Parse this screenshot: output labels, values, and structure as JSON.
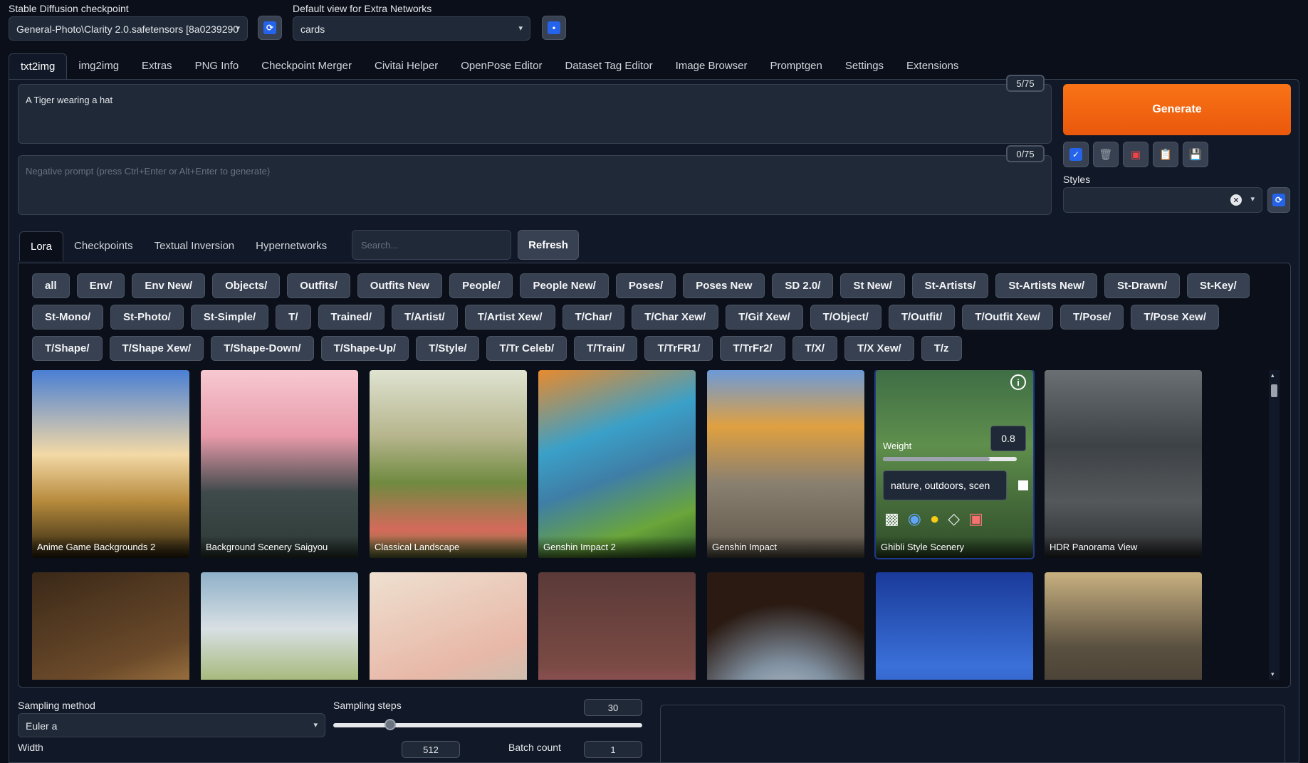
{
  "top": {
    "checkpoint_label": "Stable Diffusion checkpoint",
    "checkpoint_value": "General-Photo\\Clarity 2.0.safetensors [8a0239290",
    "extra_networks_label": "Default view for Extra Networks",
    "extra_networks_value": "cards"
  },
  "tabs": [
    "txt2img",
    "img2img",
    "Extras",
    "PNG Info",
    "Checkpoint Merger",
    "Civitai Helper",
    "OpenPose Editor",
    "Dataset Tag Editor",
    "Image Browser",
    "Promptgen",
    "Settings",
    "Extensions"
  ],
  "prompt": {
    "text": "A Tiger wearing a hat",
    "counter": "5/75",
    "negative_placeholder": "Negative prompt (press Ctrl+Enter or Alt+Enter to generate)",
    "negative_counter": "0/75"
  },
  "generate_label": "Generate",
  "styles_label": "Styles",
  "network_tabs": [
    "Lora",
    "Checkpoints",
    "Textual Inversion",
    "Hypernetworks"
  ],
  "search_placeholder": "Search...",
  "refresh_label": "Refresh",
  "filters": [
    "all",
    "Env/",
    "Env New/",
    "Objects/",
    "Outfits/",
    "Outfits New",
    "People/",
    "People New/",
    "Poses/",
    "Poses New",
    "SD 2.0/",
    "St New/",
    "St-Artists/",
    "St-Artists New/",
    "St-Drawn/",
    "St-Key/",
    "St-Mono/",
    "St-Photo/",
    "St-Simple/",
    "T/",
    "Trained/",
    "T/Artist/",
    "T/Artist Xew/",
    "T/Char/",
    "T/Char Xew/",
    "T/Gif Xew/",
    "T/Object/",
    "T/Outfit/",
    "T/Outfit Xew/",
    "T/Pose/",
    "T/Pose Xew/",
    "T/Shape/",
    "T/Shape Xew/",
    "T/Shape-Down/",
    "T/Shape-Up/",
    "T/Style/",
    "T/Tr Celeb/",
    "T/Train/",
    "T/TrFR1/",
    "T/TrFr2/",
    "T/X/",
    "T/X Xew/",
    "T/z"
  ],
  "cards": [
    {
      "name": "Anime Game Backgrounds 2"
    },
    {
      "name": "Background Scenery Saigyou"
    },
    {
      "name": "Classical Landscape"
    },
    {
      "name": "Genshin Impact 2"
    },
    {
      "name": "Genshin Impact"
    },
    {
      "name": "Ghibli Style Scenery"
    },
    {
      "name": "HDR Panorama View"
    }
  ],
  "hover_card": {
    "weight_label": "Weight",
    "weight_value": "0.8",
    "weight_fraction": 0.8,
    "tags": "nature, outdoors, scen"
  },
  "sampling": {
    "method_label": "Sampling method",
    "method_value": "Euler a",
    "steps_label": "Sampling steps",
    "steps_value": "30",
    "width_label": "Width",
    "width_value": "512",
    "batch_count_label": "Batch count",
    "batch_count_value": "1"
  },
  "colors": {
    "generate": "#ea580c",
    "accent": "#2563eb"
  }
}
